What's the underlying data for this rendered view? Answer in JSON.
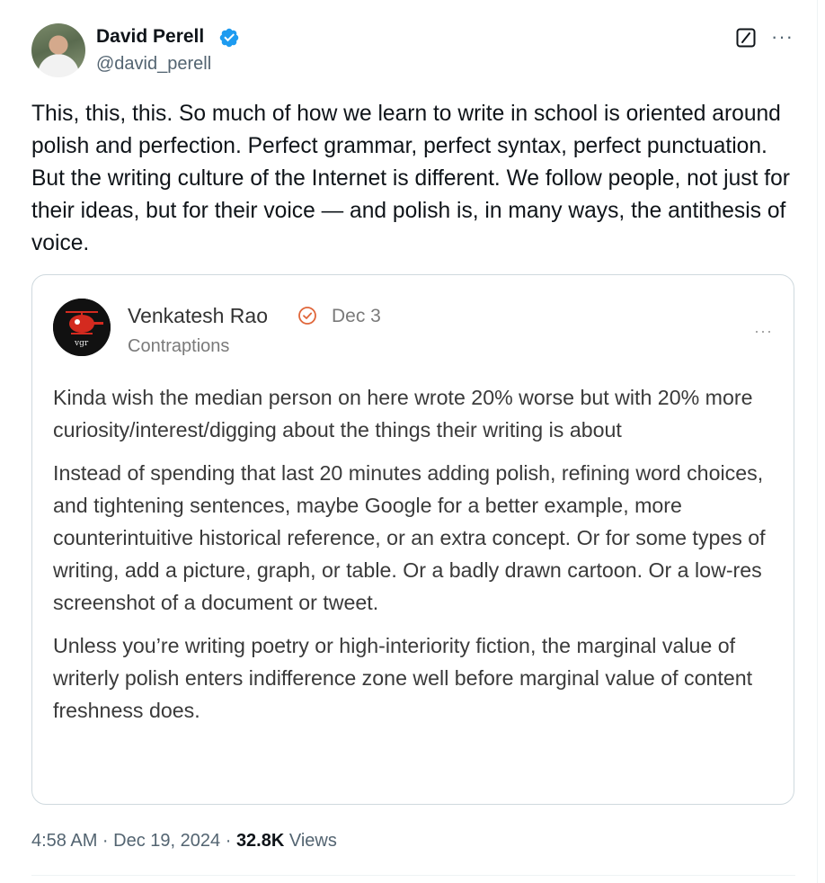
{
  "tweet": {
    "author_name": "David Perell",
    "handle": "@david_perell",
    "text": "This, this, this. So much of how we learn to write in school is oriented around polish and perfection. Perfect grammar, perfect syntax, perfect punctuation. But the writing culture of the Internet is different. We follow people, not just for their ideas, but for their voice — and polish is, in many ways, the antithesis of voice.",
    "timestamp": "4:58 AM · Dec 19, 2024",
    "separator": "·",
    "views_count": "32.8K",
    "views_label": "Views",
    "more_glyph": "···"
  },
  "quote": {
    "author_name": "Venkatesh Rao",
    "date": "Dec 3",
    "subtitle": "Contraptions",
    "avatar_text": "vgr",
    "more_glyph": "···",
    "paragraphs": [
      "Kinda wish the median person on here wrote 20% worse but with 20% more curiosity/interest/digging about the things their writing is about",
      "Instead of spending that last 20 minutes adding polish, refining word choices, and tightening sentences, maybe Google for a better example, more counterintuitive historical reference, or an extra concept. Or for some types of writing, add a picture, graph, or table. Or a badly drawn cartoon. Or a low-res screenshot of a document or tweet.",
      "Unless you’re writing poetry or high-interiority fiction, the marginal value of writerly polish enters indifference zone well before marginal value of content freshness does."
    ]
  },
  "colors": {
    "verified_blue": "#1d9bf0",
    "quote_badge_orange": "#e0663a",
    "text_primary": "#0f1419",
    "text_secondary": "#536471"
  },
  "icons": {
    "verified": "verified-badge-icon",
    "grok": "grok-icon",
    "more": "more-options-icon",
    "quote_badge": "substack-check-icon"
  }
}
